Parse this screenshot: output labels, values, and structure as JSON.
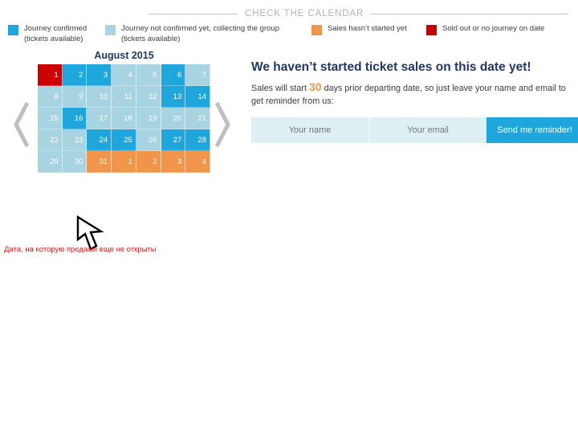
{
  "section": {
    "title": "CHECK THE CALENDAR"
  },
  "legend": {
    "items": [
      {
        "label": "Journey confirmed\n(tickets available)",
        "color": "#1fa7dd",
        "name": "legend-confirmed"
      },
      {
        "label": "Journey not confirmed yet, collecting the group\n(tickets available)",
        "color": "#a8d4e2",
        "name": "legend-not-confirmed"
      },
      {
        "label": "Sales hasn’t started yet",
        "color": "#f0954a",
        "name": "legend-sales-not-started"
      },
      {
        "label": "Sold out or no journey on date",
        "color": "#cc0000",
        "name": "legend-sold-out"
      }
    ]
  },
  "calendar": {
    "month_title": "August 2015",
    "prev_icon": "chevron-left-icon",
    "next_icon": "chevron-right-icon",
    "note": "Дата, на которую продажи еще не открыты",
    "cursor_icon": "mouse-cursor-arrow",
    "legend_colors": {
      "light": "#a8d4e2",
      "bright": "#1fa7dd",
      "orange": "#f0954a",
      "red": "#cc0000"
    },
    "days": [
      {
        "n": "1",
        "state": "red"
      },
      {
        "n": "2",
        "state": "bright"
      },
      {
        "n": "3",
        "state": "bright"
      },
      {
        "n": "4",
        "state": "light"
      },
      {
        "n": "5",
        "state": "light"
      },
      {
        "n": "6",
        "state": "bright"
      },
      {
        "n": "7",
        "state": "light"
      },
      {
        "n": "8",
        "state": "light"
      },
      {
        "n": "9",
        "state": "light"
      },
      {
        "n": "10",
        "state": "light"
      },
      {
        "n": "11",
        "state": "light"
      },
      {
        "n": "12",
        "state": "light"
      },
      {
        "n": "13",
        "state": "bright"
      },
      {
        "n": "14",
        "state": "bright"
      },
      {
        "n": "15",
        "state": "light"
      },
      {
        "n": "16",
        "state": "bright"
      },
      {
        "n": "17",
        "state": "light"
      },
      {
        "n": "18",
        "state": "light"
      },
      {
        "n": "19",
        "state": "light"
      },
      {
        "n": "20",
        "state": "light"
      },
      {
        "n": "21",
        "state": "light"
      },
      {
        "n": "22",
        "state": "light"
      },
      {
        "n": "23",
        "state": "light"
      },
      {
        "n": "24",
        "state": "bright"
      },
      {
        "n": "25",
        "state": "bright"
      },
      {
        "n": "26",
        "state": "light"
      },
      {
        "n": "27",
        "state": "bright"
      },
      {
        "n": "28",
        "state": "bright"
      },
      {
        "n": "29",
        "state": "light"
      },
      {
        "n": "30",
        "state": "light"
      },
      {
        "n": "31",
        "state": "orange"
      },
      {
        "n": "1",
        "state": "orange"
      },
      {
        "n": "2",
        "state": "orange"
      },
      {
        "n": "3",
        "state": "orange"
      },
      {
        "n": "4",
        "state": "orange"
      }
    ]
  },
  "panel": {
    "heading": "We haven’t started ticket sales on this date yet!",
    "sub_before": "Sales will start ",
    "sub_number": "30",
    "sub_after": " days prior departing date, so just leave your name and email to get reminder from us:",
    "form": {
      "name_placeholder": "Your name",
      "name_value": "",
      "email_placeholder": "Your email",
      "email_value": "",
      "submit_label": "Send me reminder!"
    }
  }
}
